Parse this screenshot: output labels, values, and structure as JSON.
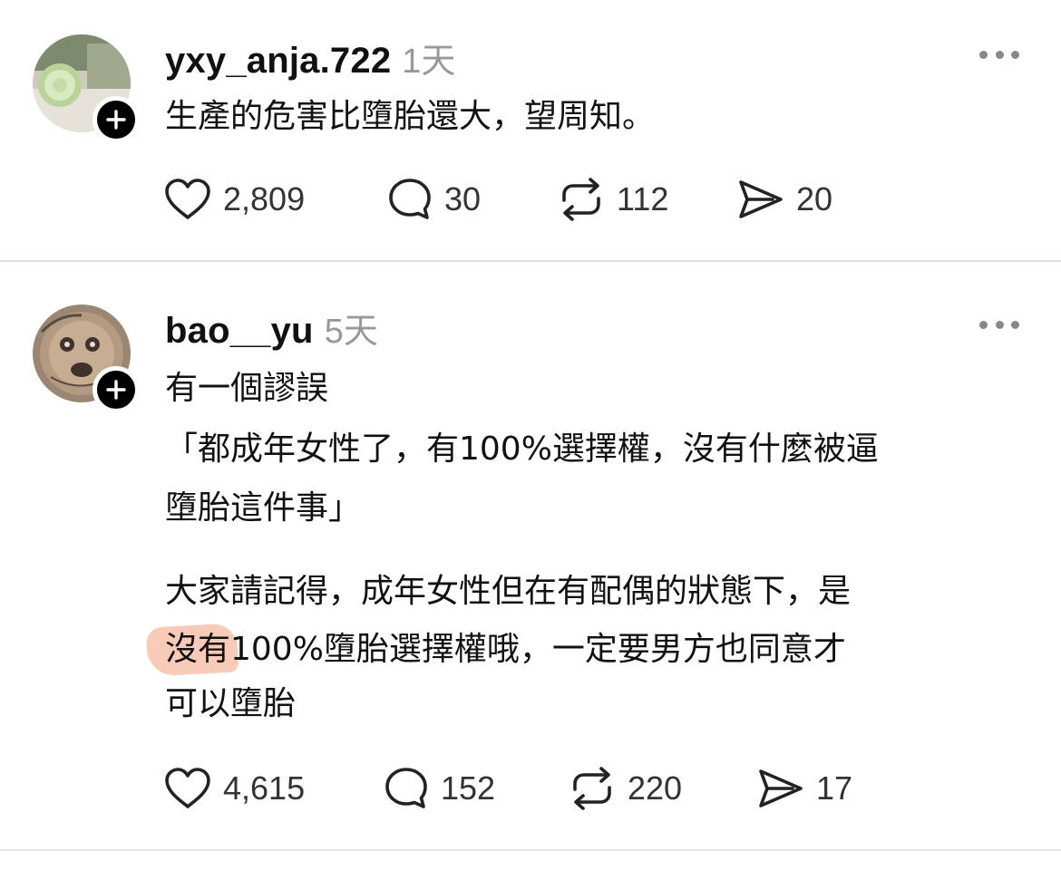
{
  "posts": [
    {
      "username": "yxy_anja.722",
      "time": "1天",
      "lines": [
        "生產的危害比墮胎還大，望周知。"
      ],
      "likes": "2,809",
      "replies": "30",
      "reposts": "112",
      "shares": "20"
    },
    {
      "username": "bao__yu",
      "time": "5天",
      "lines": [
        "有一個謬誤",
        "「都成年女性了，有100%選擇權，沒有什麼被逼",
        "墮胎這件事」",
        "大家請記得，成年女性但在有配偶的狀態下，是",
        "沒有100%墮胎選擇權哦，一定要男方也同意才",
        "可以墮胎"
      ],
      "likes": "4,615",
      "replies": "152",
      "reposts": "220",
      "shares": "17"
    }
  ],
  "icons": {
    "like": "heart-icon",
    "reply": "comment-bubble-icon",
    "repost": "repost-arrows-icon",
    "share": "send-paper-plane-icon",
    "more": "more-dots-icon",
    "follow": "plus-icon"
  },
  "colors": {
    "highlight": "#f6b9a0",
    "muted": "#999999",
    "divider": "#e3e3e3"
  }
}
